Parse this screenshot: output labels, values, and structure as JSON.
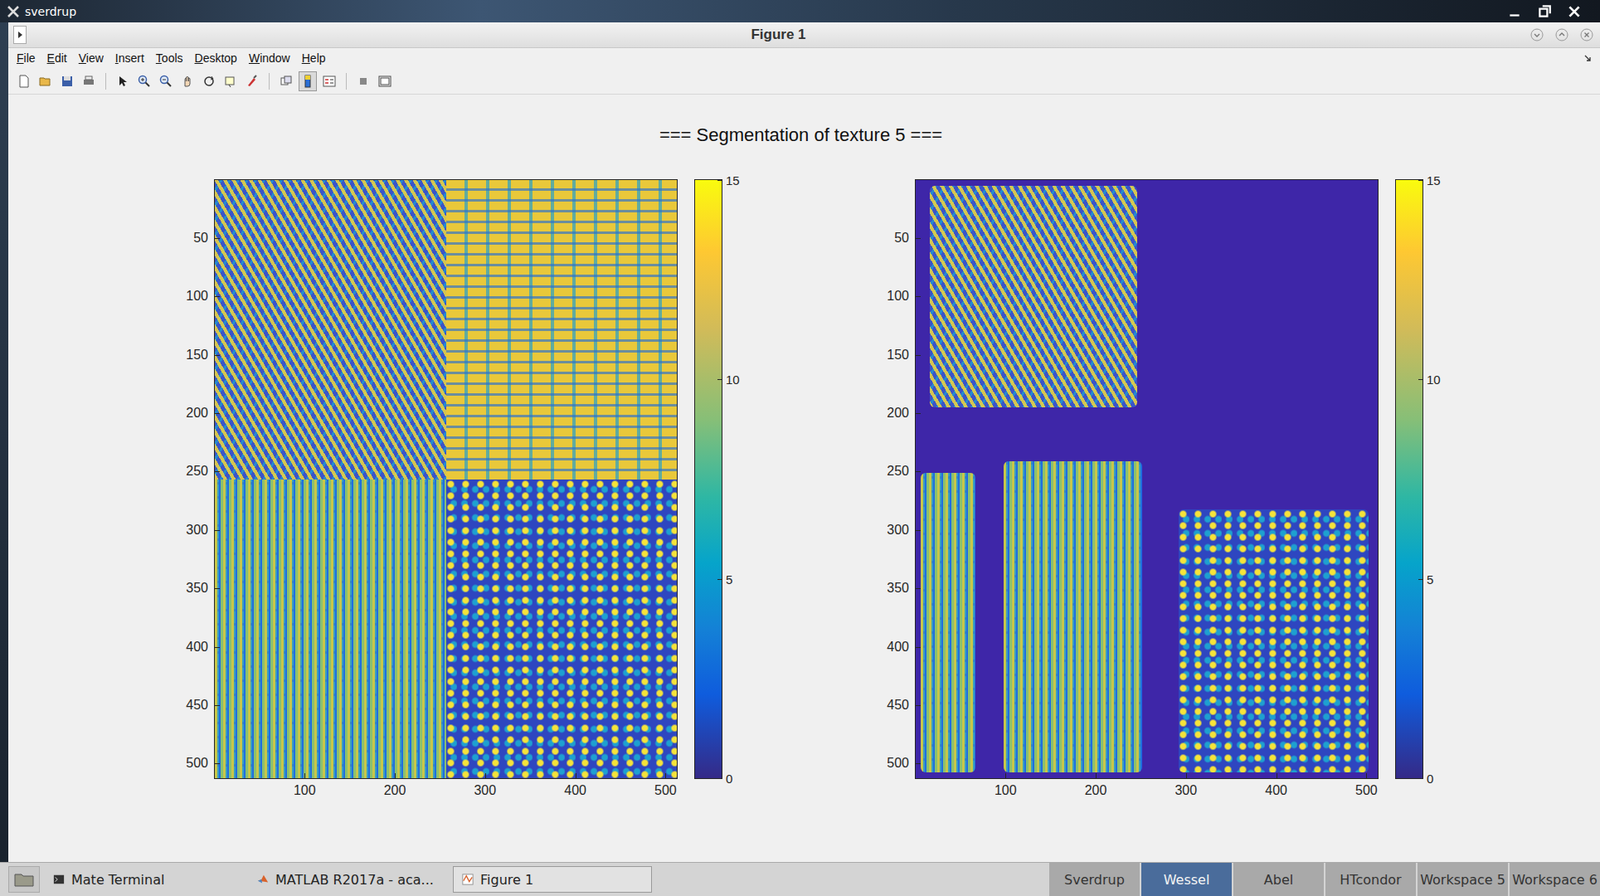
{
  "desktop": {
    "host": "sverdrup"
  },
  "window": {
    "title": "Figure 1"
  },
  "menu": [
    "File",
    "Edit",
    "View",
    "Insert",
    "Tools",
    "Desktop",
    "Window",
    "Help"
  ],
  "figure": {
    "title": "=== Segmentation of texture 5 ===",
    "axes": [
      {
        "name": "original",
        "yticks": [
          "50",
          "100",
          "150",
          "200",
          "250",
          "300",
          "350",
          "400",
          "450",
          "500"
        ],
        "xticks": [
          "100",
          "200",
          "300",
          "400",
          "500"
        ],
        "colorbar": [
          "15",
          "10",
          "5",
          "0"
        ]
      },
      {
        "name": "segmented",
        "yticks": [
          "50",
          "100",
          "150",
          "200",
          "250",
          "300",
          "350",
          "400",
          "450",
          "500"
        ],
        "xticks": [
          "100",
          "200",
          "300",
          "400",
          "500"
        ],
        "colorbar": [
          "15",
          "10",
          "5",
          "0"
        ]
      }
    ]
  },
  "taskbar": {
    "windows": [
      {
        "label": "Mate Terminal",
        "selected": false
      },
      {
        "label": "MATLAB R2017a - aca...",
        "selected": false
      },
      {
        "label": "Figure 1",
        "selected": true
      }
    ],
    "workspaces": [
      {
        "label": "Sverdrup",
        "selected": false
      },
      {
        "label": "Wessel",
        "selected": true
      },
      {
        "label": "Abel",
        "selected": false
      },
      {
        "label": "HTcondor",
        "selected": false
      },
      {
        "label": "Workspace 5",
        "selected": false
      },
      {
        "label": "Workspace 6",
        "selected": false
      }
    ]
  }
}
